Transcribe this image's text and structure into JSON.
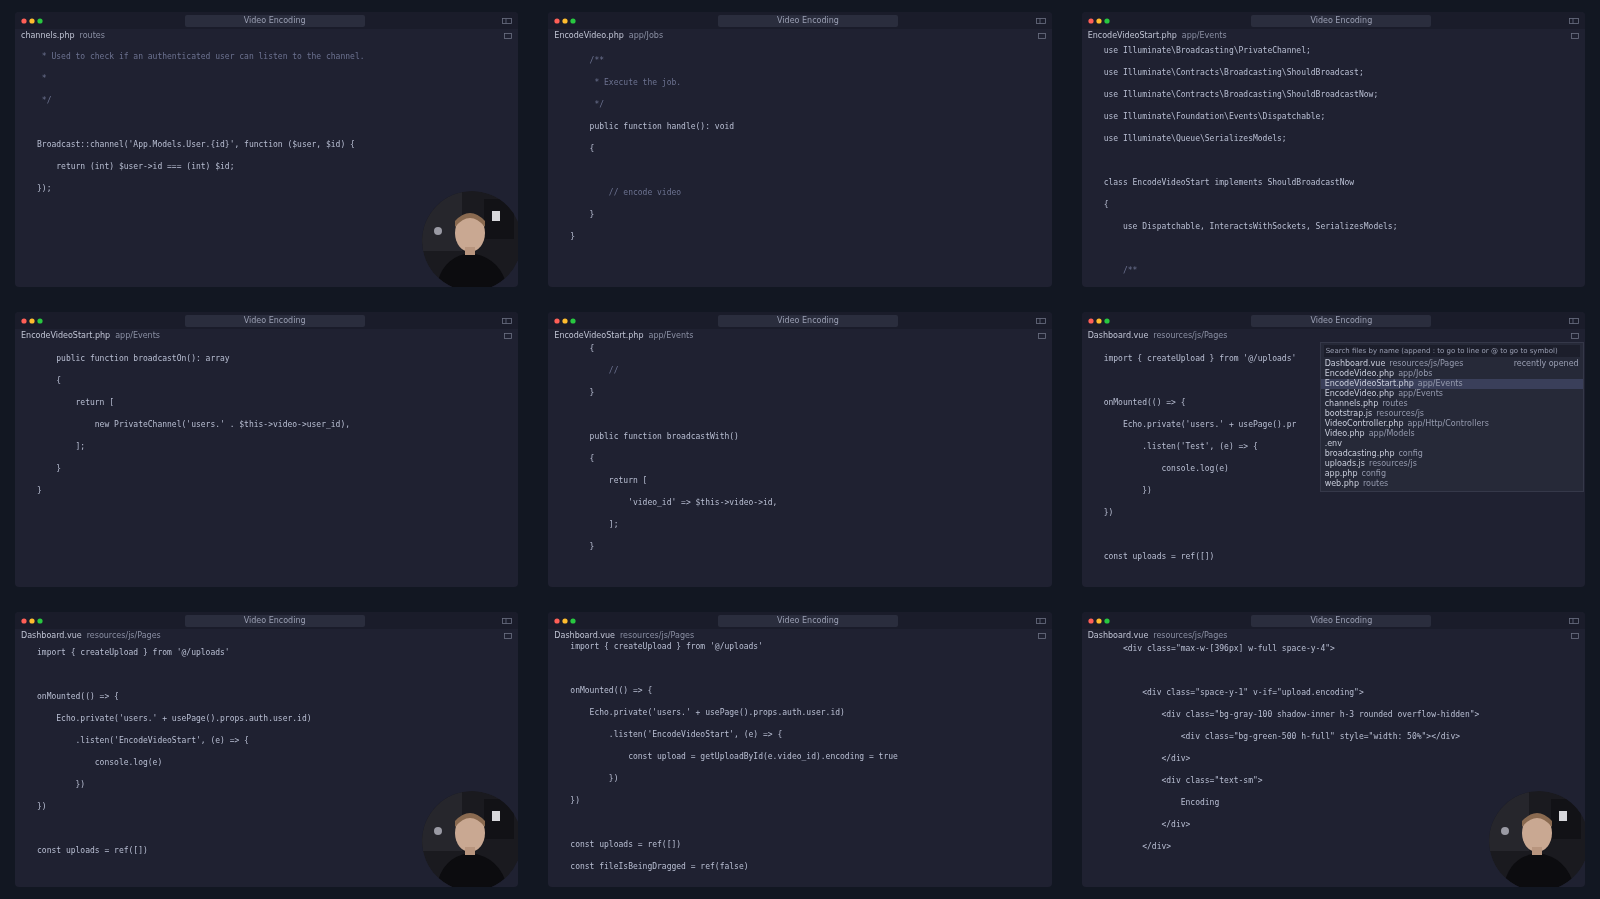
{
  "panels": [
    {
      "title": "Video Encoding",
      "tab": "channels.php",
      "path": "routes",
      "webcam": true,
      "lines": [
        {
          "kind": "comment",
          "text": " * Used to check if an authenticated user can listen to the channel."
        },
        {
          "kind": "comment",
          "text": " *"
        },
        {
          "kind": "comment",
          "text": " */"
        },
        {
          "kind": "blank"
        },
        {
          "kind": "code",
          "text": "Broadcast::channel('App.Models.User.{id}', function ($user, $id) {"
        },
        {
          "kind": "code",
          "text": "    return (int) $user->id === (int) $id;"
        },
        {
          "kind": "code",
          "text": "});"
        }
      ]
    },
    {
      "title": "Video Encoding",
      "tab": "EncodeVideo.php",
      "path": "app/Jobs",
      "webcam": false,
      "lines": [
        {
          "kind": "comment",
          "text": "    /**"
        },
        {
          "kind": "comment",
          "text": "     * Execute the job."
        },
        {
          "kind": "comment",
          "text": "     */"
        },
        {
          "kind": "code",
          "text": "    public function handle(): void"
        },
        {
          "kind": "code",
          "text": "    {"
        },
        {
          "kind": "blank"
        },
        {
          "kind": "comment",
          "text": "        // encode video"
        },
        {
          "kind": "code",
          "text": "    }"
        },
        {
          "kind": "code",
          "text": "}"
        }
      ]
    },
    {
      "title": "Video Encoding",
      "tab": "EncodeVideoStart.php",
      "path": "app/Events",
      "webcam": false,
      "lines": [
        {
          "kind": "code",
          "text": "use Illuminate\\Broadcasting\\PrivateChannel;"
        },
        {
          "kind": "code",
          "text": "use Illuminate\\Contracts\\Broadcasting\\ShouldBroadcast;"
        },
        {
          "kind": "code",
          "text": "use Illuminate\\Contracts\\Broadcasting\\ShouldBroadcastNow;"
        },
        {
          "kind": "code",
          "text": "use Illuminate\\Foundation\\Events\\Dispatchable;"
        },
        {
          "kind": "code",
          "text": "use Illuminate\\Queue\\SerializesModels;"
        },
        {
          "kind": "blank"
        },
        {
          "kind": "code",
          "text": "class EncodeVideoStart implements ShouldBroadcastNow"
        },
        {
          "kind": "code",
          "text": "{"
        },
        {
          "kind": "code",
          "text": "    use Dispatchable, InteractsWithSockets, SerializesModels;"
        },
        {
          "kind": "blank"
        },
        {
          "kind": "comment",
          "text": "    /**"
        }
      ]
    },
    {
      "title": "Video Encoding",
      "tab": "EncodeVideoStart.php",
      "path": "app/Events",
      "webcam": false,
      "lines": [
        {
          "kind": "code",
          "text": "    public function broadcastOn(): array"
        },
        {
          "kind": "code",
          "text": "    {"
        },
        {
          "kind": "code",
          "text": "        return ["
        },
        {
          "kind": "code",
          "text": "            new PrivateChannel('users.' . $this->video->user_id),"
        },
        {
          "kind": "code",
          "text": "        ];"
        },
        {
          "kind": "code",
          "text": "    }"
        },
        {
          "kind": "code",
          "text": "}"
        }
      ]
    },
    {
      "title": "Video Encoding",
      "tab": "EncodeVideoStart.php",
      "path": "app/Events",
      "webcam": false,
      "lines": [
        {
          "kind": "code",
          "text": "    {"
        },
        {
          "kind": "comment",
          "text": "        //"
        },
        {
          "kind": "code",
          "text": "    }"
        },
        {
          "kind": "blank"
        },
        {
          "kind": "code",
          "text": "    public function broadcastWith()"
        },
        {
          "kind": "code",
          "text": "    {"
        },
        {
          "kind": "code",
          "text": "        return ["
        },
        {
          "kind": "code",
          "text": "            'video_id' => $this->video->id,"
        },
        {
          "kind": "code",
          "text": "        ];"
        },
        {
          "kind": "code",
          "text": "    }"
        }
      ]
    },
    {
      "title": "Video Encoding",
      "tab": "Dashboard.vue",
      "path": "resources/js/Pages",
      "webcam": false,
      "palette": {
        "placeholder": "Search files by name (append : to go to line or @ to go to symbol)",
        "note": "recently opened",
        "items": [
          {
            "name": "Dashboard.vue",
            "path": "resources/js/Pages",
            "selected": false
          },
          {
            "name": "EncodeVideo.php",
            "path": "app/Jobs",
            "selected": false
          },
          {
            "name": "EncodeVideoStart.php",
            "path": "app/Events",
            "selected": true
          },
          {
            "name": "EncodeVideo.php",
            "path": "app/Events",
            "selected": false
          },
          {
            "name": "channels.php",
            "path": "routes",
            "selected": false
          },
          {
            "name": "bootstrap.js",
            "path": "resources/js",
            "selected": false
          },
          {
            "name": "VideoController.php",
            "path": "app/Http/Controllers",
            "selected": false
          },
          {
            "name": "Video.php",
            "path": "app/Models",
            "selected": false
          },
          {
            "name": ".env",
            "selected": false
          },
          {
            "name": "broadcasting.php",
            "path": "config",
            "selected": false
          },
          {
            "name": "uploads.js",
            "path": "resources/js",
            "selected": false
          },
          {
            "name": "app.php",
            "path": "config",
            "selected": false
          },
          {
            "name": "web.php",
            "path": "routes",
            "selected": false
          }
        ]
      },
      "lines": [
        {
          "kind": "code",
          "text": "import { createUpload } from '@/uploads'"
        },
        {
          "kind": "blank"
        },
        {
          "kind": "code",
          "text": "onMounted(() => {"
        },
        {
          "kind": "code",
          "text": "    Echo.private('users.' + usePage().pr"
        },
        {
          "kind": "code",
          "text": "        .listen('Test', (e) => {"
        },
        {
          "kind": "code",
          "text": "            console.log(e)"
        },
        {
          "kind": "code",
          "text": "        })"
        },
        {
          "kind": "code",
          "text": "})"
        },
        {
          "kind": "blank"
        },
        {
          "kind": "code",
          "text": "const uploads = ref([])"
        }
      ]
    },
    {
      "title": "Video Encoding",
      "tab": "Dashboard.vue",
      "path": "resources/js/Pages",
      "webcam": true,
      "lines": [
        {
          "kind": "code",
          "text": "import { createUpload } from '@/uploads'"
        },
        {
          "kind": "blank"
        },
        {
          "kind": "code",
          "text": "onMounted(() => {"
        },
        {
          "kind": "code",
          "text": "    Echo.private('users.' + usePage().props.auth.user.id)"
        },
        {
          "kind": "code",
          "text": "        .listen('EncodeVideoStart', (e) => {"
        },
        {
          "kind": "code",
          "text": "            console.log(e)"
        },
        {
          "kind": "code",
          "text": "        })"
        },
        {
          "kind": "code",
          "text": "})"
        },
        {
          "kind": "blank"
        },
        {
          "kind": "code",
          "text": "const uploads = ref([])"
        }
      ]
    },
    {
      "title": "Video Encoding",
      "tab": "Dashboard.vue",
      "path": "resources/js/Pages",
      "webcam": false,
      "lines": [
        {
          "kind": "code",
          "text": "import { createUpload } from '@/uploads'"
        },
        {
          "kind": "blank"
        },
        {
          "kind": "code",
          "text": "onMounted(() => {"
        },
        {
          "kind": "code",
          "text": "    Echo.private('users.' + usePage().props.auth.user.id)"
        },
        {
          "kind": "code",
          "text": "        .listen('EncodeVideoStart', (e) => {"
        },
        {
          "kind": "code",
          "text": "            const upload = getUploadById(e.video_id).encoding = true"
        },
        {
          "kind": "code",
          "text": "        })"
        },
        {
          "kind": "code",
          "text": "})"
        },
        {
          "kind": "blank"
        },
        {
          "kind": "code",
          "text": "const uploads = ref([])"
        },
        {
          "kind": "code",
          "text": "const fileIsBeingDragged = ref(false)"
        }
      ]
    },
    {
      "title": "Video Encoding",
      "tab": "Dashboard.vue",
      "path": "resources/js/Pages",
      "webcam": true,
      "lines": [
        {
          "kind": "code",
          "text": "    <div class=\"max-w-[396px] w-full space-y-4\">"
        },
        {
          "kind": "blank"
        },
        {
          "kind": "code",
          "text": "        <div class=\"space-y-1\" v-if=\"upload.encoding\">"
        },
        {
          "kind": "code",
          "text": "            <div class=\"bg-gray-100 shadow-inner h-3 rounded overflow-hidden\">"
        },
        {
          "kind": "code",
          "text": "                <div class=\"bg-green-500 h-full\" style=\"width: 50%\"></div>"
        },
        {
          "kind": "code",
          "text": "            </div>"
        },
        {
          "kind": "code",
          "text": "            <div class=\"text-sm\">"
        },
        {
          "kind": "code",
          "text": "                Encoding"
        },
        {
          "kind": "code",
          "text": "            </div>"
        },
        {
          "kind": "code",
          "text": "        </div>"
        }
      ]
    }
  ]
}
